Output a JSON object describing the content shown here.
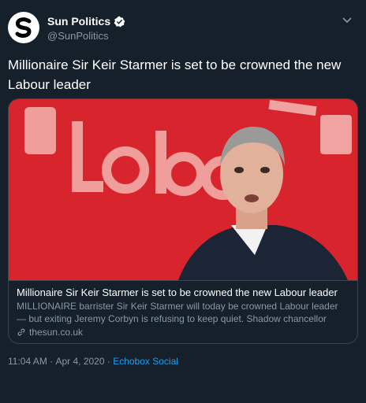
{
  "author": {
    "display_name": "Sun Politics",
    "handle": "@SunPolitics",
    "verified": true,
    "avatar_icon": "sun-s-logo"
  },
  "tweet": {
    "text": "Millionaire Sir Keir Starmer is set to be crowned the new Labour leader"
  },
  "card": {
    "image_description_icon": "article-photo",
    "title": "Millionaire Sir Keir Starmer is set to be crowned the new Labour leader",
    "description": "MILLIONAIRE barrister Sir Keir Starmer will today be crowned Labour leader — but exiting Jeremy Corbyn is refusing to keep quiet. Shadow chancellor John ...",
    "domain": "thesun.co.uk",
    "link_icon": "link-icon"
  },
  "meta": {
    "time": "11:04 AM",
    "separator1": " · ",
    "date": "Apr 4, 2020",
    "separator2": " · ",
    "source": "Echobox Social"
  },
  "colors": {
    "background": "#15202b",
    "secondary_text": "#8899a6",
    "accent": "#1da1f2",
    "labour_red": "#e0272e"
  }
}
